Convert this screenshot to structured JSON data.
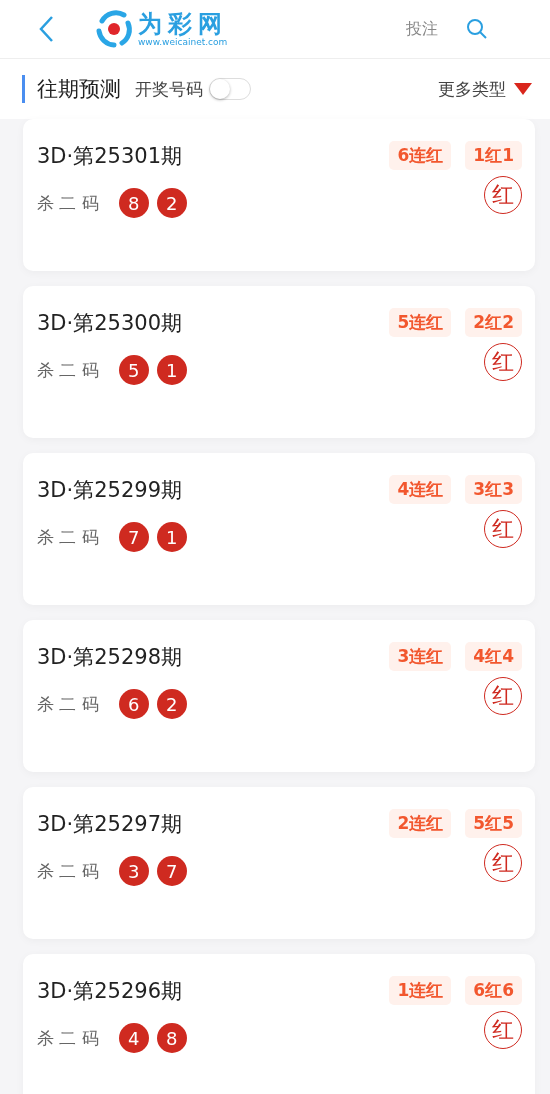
{
  "header": {
    "logo_text": "为彩网",
    "logo_url": "www.weicainet.com",
    "action": "投注"
  },
  "section": {
    "title": "往期预测",
    "toggle_label": "开奖号码",
    "toggle_on": false,
    "more": "更多类型"
  },
  "records": [
    {
      "issue": "3D·第25301期",
      "streak": "6连红",
      "ratio": "1红1",
      "label": "杀 二 码",
      "numbers": [
        "8",
        "2"
      ],
      "result": "红"
    },
    {
      "issue": "3D·第25300期",
      "streak": "5连红",
      "ratio": "2红2",
      "label": "杀 二 码",
      "numbers": [
        "5",
        "1"
      ],
      "result": "红"
    },
    {
      "issue": "3D·第25299期",
      "streak": "4连红",
      "ratio": "3红3",
      "label": "杀 二 码",
      "numbers": [
        "7",
        "1"
      ],
      "result": "红"
    },
    {
      "issue": "3D·第25298期",
      "streak": "3连红",
      "ratio": "4红4",
      "label": "杀 二 码",
      "numbers": [
        "6",
        "2"
      ],
      "result": "红"
    },
    {
      "issue": "3D·第25297期",
      "streak": "2连红",
      "ratio": "5红5",
      "label": "杀 二 码",
      "numbers": [
        "3",
        "7"
      ],
      "result": "红"
    },
    {
      "issue": "3D·第25296期",
      "streak": "1连红",
      "ratio": "6红6",
      "label": "杀 二 码",
      "numbers": [
        "4",
        "8"
      ],
      "result": "红"
    }
  ]
}
